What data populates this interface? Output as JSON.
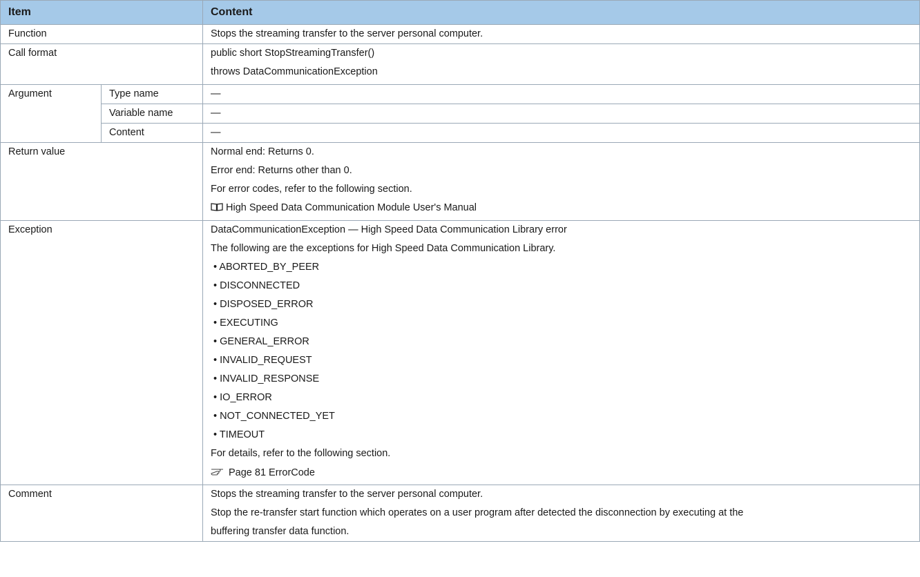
{
  "header": {
    "item": "Item",
    "content": "Content"
  },
  "function": {
    "label": "Function",
    "text": "Stops the streaming transfer to the server personal computer."
  },
  "call_format": {
    "label": "Call format",
    "lines": [
      "public short StopStreamingTransfer()",
      "throws DataCommunicationException"
    ]
  },
  "argument": {
    "label": "Argument",
    "rows": [
      {
        "label": "Type name",
        "value": "—"
      },
      {
        "label": "Variable name",
        "value": "—"
      },
      {
        "label": "Content",
        "value": "—"
      }
    ]
  },
  "return_value": {
    "label": "Return value",
    "lines": [
      "Normal end: Returns 0.",
      "Error end: Returns other than 0.",
      "For error codes, refer to the following section."
    ],
    "manual_ref": "High Speed Data Communication Module User's Manual",
    "manual_icon": "manual-book-icon"
  },
  "exception": {
    "label": "Exception",
    "lines": [
      "DataCommunicationException — High Speed Data Communication Library error",
      "The following are the exceptions for High Speed Data Communication Library."
    ],
    "bullets": [
      "ABORTED_BY_PEER",
      "DISCONNECTED",
      "DISPOSED_ERROR",
      "EXECUTING",
      "GENERAL_ERROR",
      "INVALID_REQUEST",
      "INVALID_RESPONSE",
      "IO_ERROR",
      "NOT_CONNECTED_YET",
      "TIMEOUT"
    ],
    "details": "For details, refer to the following section.",
    "page_ref": "Page 81 ErrorCode",
    "page_icon": "pointing-hand-icon"
  },
  "comment": {
    "label": "Comment",
    "lines": [
      "Stops the streaming transfer to the server personal computer.",
      "Stop the re-transfer start function which operates on a user program after detected the disconnection by executing at the",
      "buffering transfer data function."
    ]
  }
}
